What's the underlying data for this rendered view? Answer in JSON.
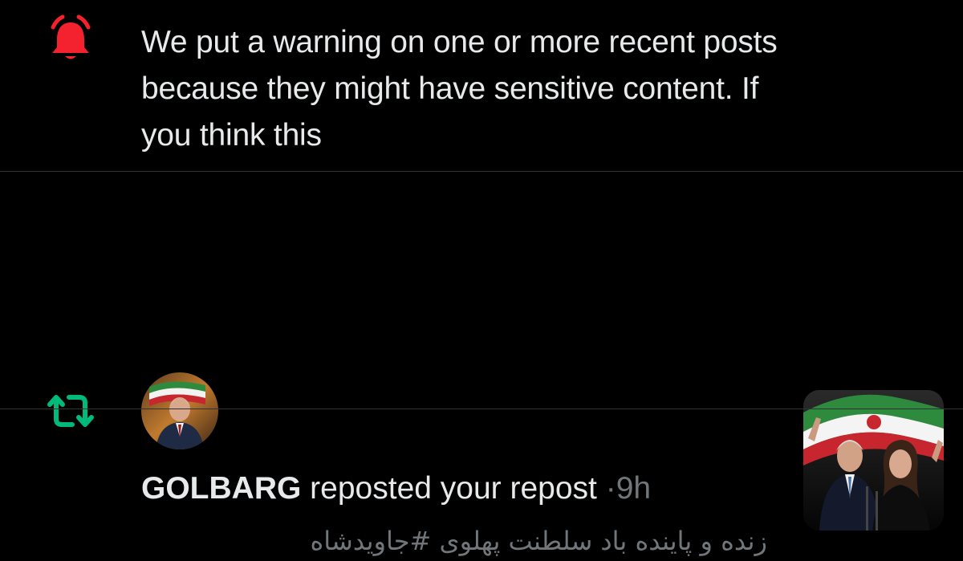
{
  "notifications": [
    {
      "type": "warning",
      "icon": "alert-bell-icon",
      "icon_color": "#f4212e",
      "text": "We put a warning on one or more recent posts because they might have sensitive content. If you think this"
    },
    {
      "type": "repost",
      "icon": "repost-icon",
      "icon_color": "#00ba7c",
      "user_name": "GOLBARG",
      "action_text": "reposted your repost",
      "separator": "·",
      "time": "9h",
      "post_text": "زنده و پاینده باد سلطنت پهلوی #جاویدشاه"
    }
  ],
  "colors": {
    "background": "#000000",
    "text_primary": "#e7e9ea",
    "text_secondary": "#71767b",
    "divider": "#2f3336"
  }
}
